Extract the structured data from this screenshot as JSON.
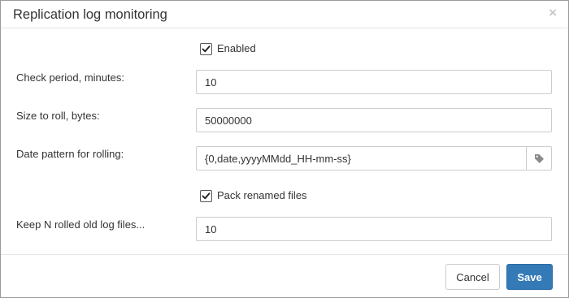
{
  "dialog": {
    "title": "Replication log monitoring",
    "close_glyph": "×"
  },
  "form": {
    "enabled": {
      "label": "Enabled",
      "checked": true
    },
    "check_period": {
      "label": "Check period, minutes:",
      "value": "10"
    },
    "size_to_roll": {
      "label": "Size to roll, bytes:",
      "value": "50000000"
    },
    "date_pattern": {
      "label": "Date pattern for rolling:",
      "value": "{0,date,yyyyMMdd_HH-mm-ss}",
      "addon_icon": "tag-icon"
    },
    "pack_renamed": {
      "label": "Pack renamed files",
      "checked": true
    },
    "keep_n": {
      "label": "Keep N rolled old log files...",
      "value": "10"
    }
  },
  "footer": {
    "cancel_label": "Cancel",
    "save_label": "Save"
  },
  "colors": {
    "primary": "#337ab7",
    "border": "#cccccc",
    "text": "#333333"
  }
}
